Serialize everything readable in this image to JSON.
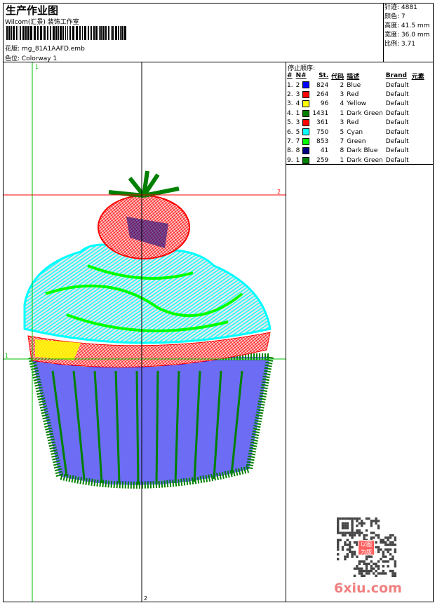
{
  "header": {
    "title": "生产作业图",
    "company": "Wilcom(汇景) 装饰工作室",
    "design_label": "花版:",
    "design_value": "mg_81A1AAFD.emb",
    "colorway_label": "色位:",
    "colorway_value": "Colorway 1"
  },
  "stats": [
    {
      "label": "针迹:",
      "value": "4881"
    },
    {
      "label": "颜色:",
      "value": "7"
    },
    {
      "label": "高度:",
      "value": "41.5 mm"
    },
    {
      "label": "宽度:",
      "value": "36.0 mm"
    },
    {
      "label": "比例:",
      "value": "3.71"
    }
  ],
  "stop_sequence": {
    "title": "停止顺序:",
    "columns": [
      "#",
      "N#",
      "St.",
      "代码",
      "描述",
      "Brand",
      "元素"
    ],
    "rows": [
      {
        "n": "1.",
        "nn": "2",
        "color": "#0000ff",
        "st": "824",
        "code": "2",
        "desc": "Blue",
        "brand": "Default"
      },
      {
        "n": "2.",
        "nn": "3",
        "color": "#ff0000",
        "st": "264",
        "code": "3",
        "desc": "Red",
        "brand": "Default"
      },
      {
        "n": "3.",
        "nn": "4",
        "color": "#ffff00",
        "st": "96",
        "code": "4",
        "desc": "Yellow",
        "brand": "Default"
      },
      {
        "n": "4.",
        "nn": "1",
        "color": "#008000",
        "st": "1431",
        "code": "1",
        "desc": "Dark Green",
        "brand": "Default"
      },
      {
        "n": "5.",
        "nn": "3",
        "color": "#ff0000",
        "st": "361",
        "code": "3",
        "desc": "Red",
        "brand": "Default"
      },
      {
        "n": "6.",
        "nn": "5",
        "color": "#00ffff",
        "st": "750",
        "code": "5",
        "desc": "Cyan",
        "brand": "Default"
      },
      {
        "n": "7.",
        "nn": "7",
        "color": "#00ff00",
        "st": "853",
        "code": "7",
        "desc": "Green",
        "brand": "Default"
      },
      {
        "n": "8.",
        "nn": "8",
        "color": "#000080",
        "st": "41",
        "code": "8",
        "desc": "Dark Blue",
        "brand": "Default"
      },
      {
        "n": "9.",
        "nn": "1",
        "color": "#008000",
        "st": "259",
        "code": "1",
        "desc": "Dark Green",
        "brand": "Default"
      }
    ]
  },
  "guides": {
    "green_top": "1",
    "green_left": "1",
    "red_right": "2",
    "black_bottom": "2"
  },
  "watermark": {
    "site": "6xiu.com",
    "stamp": "以图为版"
  }
}
